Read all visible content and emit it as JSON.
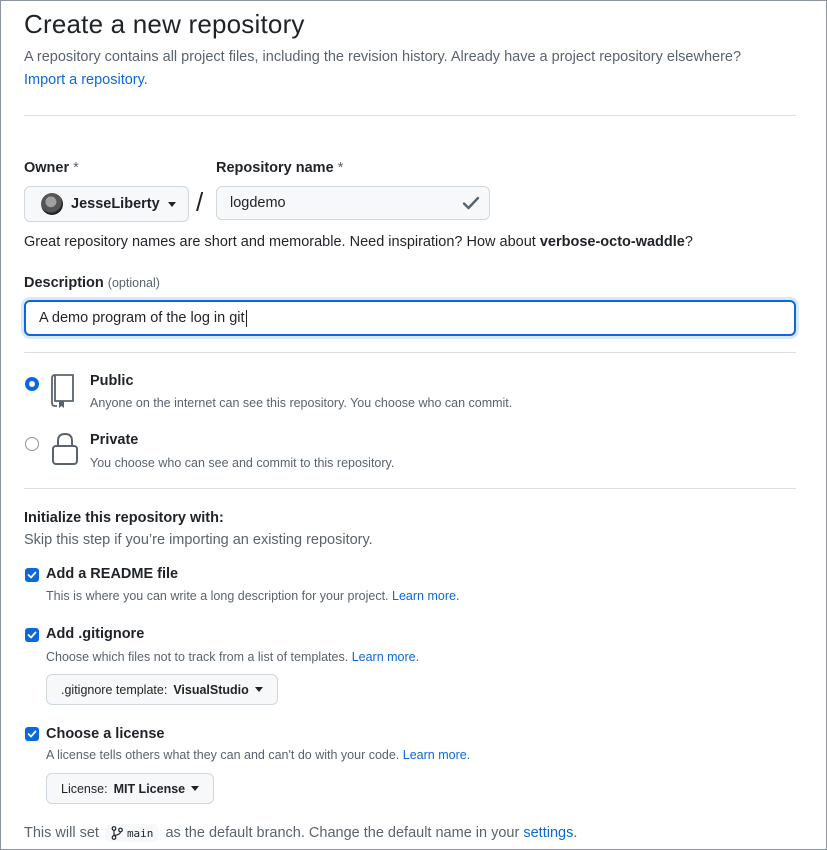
{
  "header": {
    "title": "Create a new repository",
    "intro_text": "A repository contains all project files, including the revision history. Already have a project repository elsewhere?",
    "import_link": "Import a repository."
  },
  "owner": {
    "label": "Owner",
    "required_mark": "*",
    "value": "JesseLiberty"
  },
  "repo_name": {
    "label": "Repository name",
    "required_mark": "*",
    "separator": "/",
    "value": "logdemo"
  },
  "name_hint": {
    "text": "Great repository names are short and memorable. Need inspiration? How about",
    "suggestion": "verbose-octo-waddle",
    "end": "?"
  },
  "description": {
    "label": "Description",
    "optional": "(optional)",
    "value": "A demo program of the log in git"
  },
  "visibility": {
    "selected": "public",
    "options": [
      {
        "title": "Public",
        "subtitle": "Anyone on the internet can see this repository. You choose who can commit."
      },
      {
        "title": "Private",
        "subtitle": "You choose who can see and commit to this repository."
      }
    ]
  },
  "initialize": {
    "title": "Initialize this repository with:",
    "subtitle": "Skip this step if you’re importing an existing repository.",
    "readme": {
      "label": "Add a README file",
      "desc": "This is where you can write a long description for your project.",
      "link": "Learn more.",
      "checked": true
    },
    "gitignore": {
      "label": "Add .gitignore",
      "desc": "Choose which files not to track from a list of templates.",
      "link": "Learn more.",
      "checked": true,
      "select_prefix": ".gitignore template:",
      "select_value": "VisualStudio"
    },
    "license": {
      "label": "Choose a license",
      "desc": "A license tells others what they can and can't do with your code.",
      "link": "Learn more.",
      "checked": true,
      "select_prefix": "License:",
      "select_value": "MIT License"
    }
  },
  "footer": {
    "before": "This will set",
    "branch": "main",
    "after": "as the default branch. Change the default name in your",
    "link": "settings",
    "end": "."
  },
  "colors": {
    "accent": "#0969da",
    "muted_text": "#59636e",
    "border": "#d0d7de"
  }
}
